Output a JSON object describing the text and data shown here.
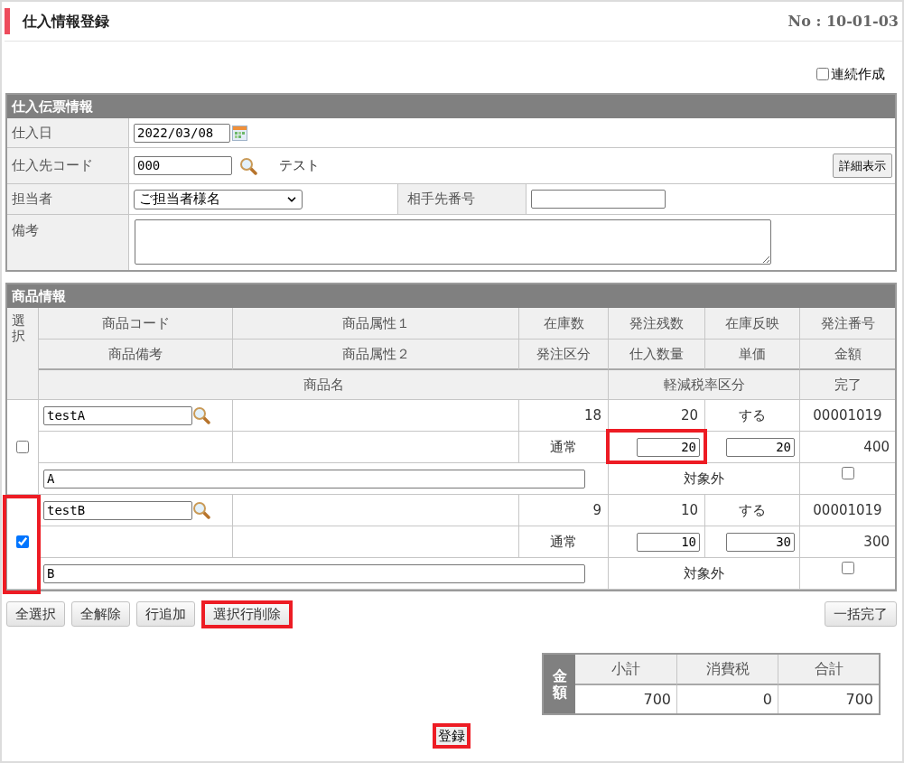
{
  "header": {
    "title": "仕入情報登録",
    "screen_no": "No : 10-01-03"
  },
  "continuous_create": {
    "label": "連続作成",
    "checked": false
  },
  "slip_section": {
    "title": "仕入伝票情報",
    "purchase_date": {
      "label": "仕入日",
      "value": "2022/03/08"
    },
    "supplier": {
      "label": "仕入先コード",
      "value": "000",
      "name": "テスト",
      "detail_button": "詳細表示"
    },
    "staff": {
      "label": "担当者",
      "value": "ご担当者様名"
    },
    "partner_no": {
      "label": "相手先番号"
    },
    "remarks": {
      "label": "備考"
    }
  },
  "product_section": {
    "title": "商品情報",
    "select_header": "選択",
    "header_rows": [
      [
        "商品コード",
        "商品属性１",
        "在庫数",
        "発注残数",
        "在庫反映",
        "発注番号"
      ],
      [
        "商品備考",
        "商品属性２",
        "発注区分",
        "仕入数量",
        "単価",
        "金額"
      ],
      [
        "商品名",
        "軽減税率区分",
        "完了"
      ]
    ],
    "items": [
      {
        "selected": false,
        "select_highlighted": false,
        "code": "testA",
        "stock_qty": "18",
        "order_remaining": "20",
        "stock_reflect": "する",
        "order_no": "00001019",
        "order_type": "通常",
        "quantity": "20",
        "quantity_highlighted": true,
        "unit_price": "20",
        "amount": "400",
        "name": "A",
        "tax_class": "対象外",
        "done": false
      },
      {
        "selected": true,
        "select_highlighted": true,
        "code": "testB",
        "stock_qty": "9",
        "order_remaining": "10",
        "stock_reflect": "する",
        "order_no": "00001019",
        "order_type": "通常",
        "quantity": "10",
        "quantity_highlighted": false,
        "unit_price": "30",
        "amount": "300",
        "name": "B",
        "tax_class": "対象外",
        "done": false
      }
    ]
  },
  "row_buttons": [
    {
      "label": "全選択",
      "highlighted": false
    },
    {
      "label": "全解除",
      "highlighted": false
    },
    {
      "label": "行追加",
      "highlighted": false
    },
    {
      "label": "選択行削除",
      "highlighted": true
    }
  ],
  "bulk_complete_button": "一括完了",
  "totals": {
    "label": "金額",
    "columns": [
      {
        "label": "小計",
        "value": "700"
      },
      {
        "label": "消費税",
        "value": "0"
      },
      {
        "label": "合計",
        "value": "700"
      }
    ]
  },
  "register_button": {
    "label": "登録",
    "highlighted": true
  }
}
